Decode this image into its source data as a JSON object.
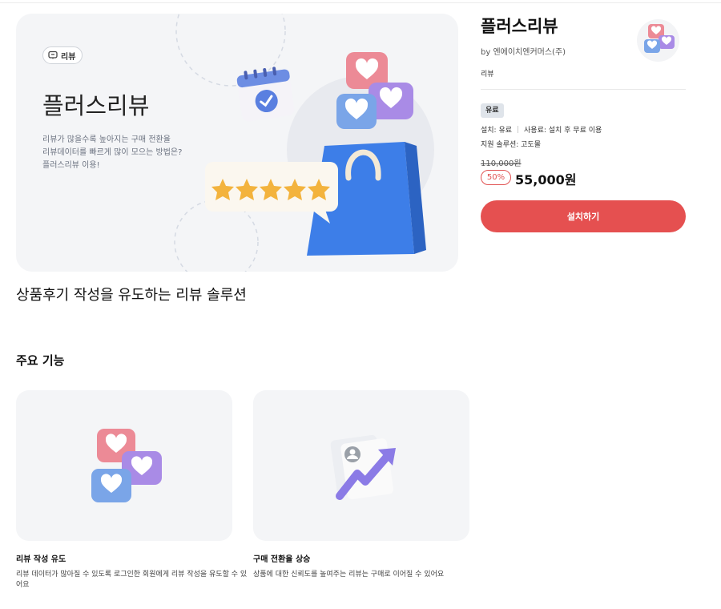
{
  "hero": {
    "badge_label": "리뷰",
    "title": "플러스리뷰",
    "description_lines": [
      "리뷰가 많을수록 높아지는 구매 전환율",
      "리뷰데이터를 빠르게 많이 모으는 방법은?",
      "플러스리뷰 이용!"
    ]
  },
  "subtitle": "상품후기 작성을 유도하는 리뷰 솔루션",
  "app": {
    "name": "플러스리뷰",
    "vendor": "by 엔에이치엔커머스(주)",
    "category": "리뷰",
    "paid_badge": "유료",
    "install_fee": "설치: 유료",
    "usage_fee": "사용료: 설치 후 무료 이용",
    "supported_solution": "지원 솔루션: 고도몰",
    "original_price": "110,000원",
    "discount": "50%",
    "price": "55,000원",
    "install_button": "설치하기"
  },
  "features": {
    "section_title": "주요 기능",
    "items": [
      {
        "title": "리뷰 작성 유도",
        "description": "리뷰 데이터가 많아질 수 있도록 로그인한 회원에게 리뷰 작성을 유도할 수 있어요"
      },
      {
        "title": "구매 전환율 상승",
        "description": "상품에 대한 신뢰도를 높여주는 리뷰는 구매로 이어질 수 있어요"
      }
    ]
  },
  "colors": {
    "accent": "#e55050",
    "card_bg": "#f4f5f7",
    "badge_bg": "#dfe4ea",
    "heart_pink": "#ec8a96",
    "heart_purple": "#a98be6",
    "heart_blue": "#7aa5e8",
    "bag_blue": "#3d7ee8",
    "star_gold": "#f3b33d"
  },
  "icons": {
    "badge": "chat-bubble-icon",
    "hero_illustration": "review-shopping-bag-illustration",
    "feature_1": "heart-bubbles-illustration",
    "feature_2": "growth-arrow-illustration"
  }
}
